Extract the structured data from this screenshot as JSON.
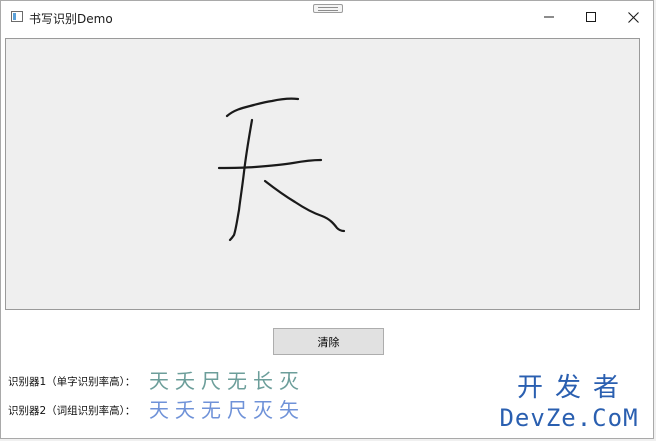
{
  "window": {
    "title": "书写识别Demo"
  },
  "canvas": {
    "stroke_color": "#1a1a1a",
    "background": "#efefef"
  },
  "actions": {
    "clear_label": "清除"
  },
  "recognizers": [
    {
      "label": "识别器1（单字识别率高）：",
      "color": "#6c9e9a",
      "candidates": [
        "天",
        "夭",
        "尺",
        "无",
        "长",
        "灭"
      ]
    },
    {
      "label": "识别器2（词组识别率高）：",
      "color": "#6f92d8",
      "candidates": [
        "天",
        "夭",
        "无",
        "尺",
        "灭",
        "矢"
      ]
    }
  ],
  "watermark": {
    "cn": "开发者",
    "en": "DevZe.CoM",
    "color": "#2a5fb0"
  }
}
